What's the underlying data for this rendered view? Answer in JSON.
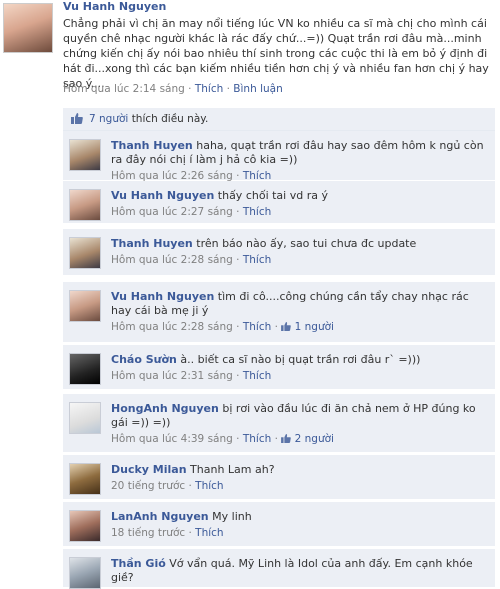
{
  "post": {
    "author": "Vu Hanh Nguyen",
    "text": "Chẳng phải vì chị ăn may nổi tiếng lúc VN ko nhiều ca sĩ mà chị cho mình cái quyền chê nhạc người khác là rác đấy chứ...=)) Quạt trần rơi đâu mà...minh chứng kiến chị ấy nói bao nhiêu thí sinh trong các cuộc thi là em bỏ ý định đi hát đi...xong thì các bạn kiếm nhiều tiền hơn chị ý và nhiều fan hơn chị ý hay sao ý....",
    "time": "Hôm qua lúc 2:14 sáng",
    "like_label": "Thích",
    "comment_label": "Bình luận",
    "likes_count_text": "7 người",
    "likes_suffix": "thích điều này."
  },
  "comments": [
    {
      "author": "Thanh Huyen",
      "text": "haha, quạt trần rơi đâu hay sao đêm hôm k ngủ còn ra đây nói chị í làm j hả cô kia =))",
      "time": "Hôm qua lúc 2:26 sáng",
      "like_label": "Thích",
      "likes": ""
    },
    {
      "author": "Vu Hanh Nguyen",
      "text": "thấy chối tai vd ra ý",
      "time": "Hôm qua lúc 2:27 sáng",
      "like_label": "Thích",
      "likes": ""
    },
    {
      "author": "Thanh Huyen",
      "text": "trên báo nào ấy, sao tui chưa đc update",
      "time": "Hôm qua lúc 2:28 sáng",
      "like_label": "Thích",
      "likes": ""
    },
    {
      "author": "Vu Hanh Nguyen",
      "text": "tìm đi cô....công chúng cần tẩy chay nhạc rác hay cái bà mẹ ji ý",
      "time": "Hôm qua lúc 2:28 sáng",
      "like_label": "Thích",
      "likes": "1 người"
    },
    {
      "author": "Cháo Sườn",
      "text": "à.. biết ca sĩ nào bị quạt trần rơi đâu r` =)))",
      "time": "Hôm qua lúc 2:31 sáng",
      "like_label": "Thích",
      "likes": ""
    },
    {
      "author": "HongAnh Nguyen",
      "text": "bị rơi vào đầu lúc đi ăn chả nem ở HP đúng ko gái =)) =))",
      "time": "Hôm qua lúc 4:39 sáng",
      "like_label": "Thích",
      "likes": "2 người"
    },
    {
      "author": "Ducky Milan",
      "text": "Thanh Lam ah?",
      "time": "20 tiếng trước",
      "like_label": "Thích",
      "likes": ""
    },
    {
      "author": "LanAnh Nguyen",
      "text": "My linh",
      "time": "18 tiếng trước",
      "like_label": "Thích",
      "likes": ""
    },
    {
      "author": "Thần Gió",
      "text": "Vớ vẩn quá. Mỹ Linh là Idol của anh đấy. Em cạnh khóe giề?",
      "time": "",
      "like_label": "",
      "likes": ""
    }
  ],
  "colors": {
    "link": "#3b5998",
    "comment_bg": "#eceff5",
    "meta": "#808080"
  }
}
